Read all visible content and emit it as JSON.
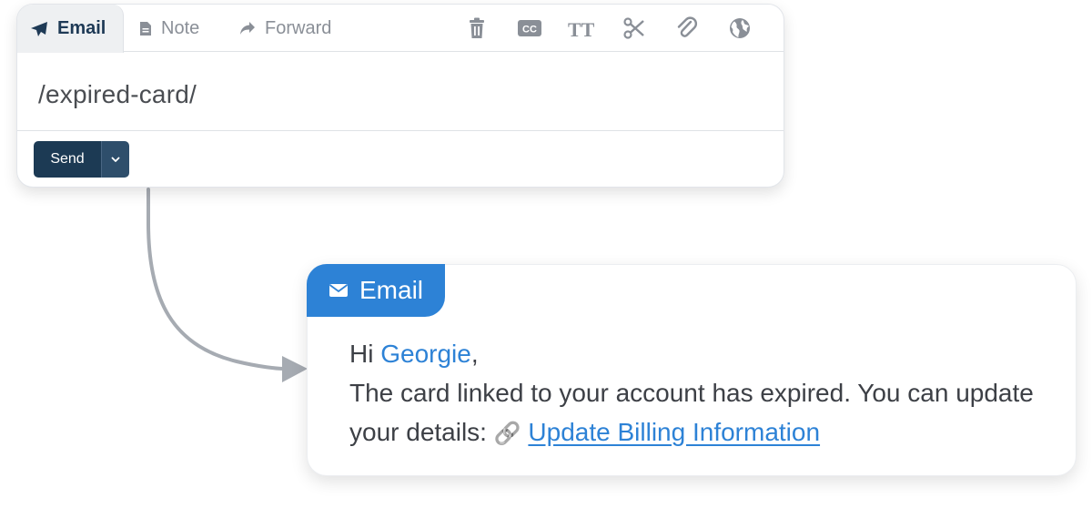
{
  "composer": {
    "tabs": [
      {
        "label": "Email",
        "icon": "paper-plane-icon",
        "active": true
      },
      {
        "label": "Note",
        "icon": "document-icon",
        "active": false
      },
      {
        "label": "Forward",
        "icon": "forward-arrow-icon",
        "active": false
      }
    ],
    "toolbar_icons": [
      "trash-icon",
      "cc-icon",
      "text-size-icon",
      "scissors-icon",
      "paperclip-icon",
      "globe-icon"
    ],
    "cc_label": "CC",
    "text_size_label": "TT",
    "editor_text": "/expired-card/",
    "send_label": "Send"
  },
  "preview": {
    "badge_label": "Email",
    "greeting_prefix": "Hi ",
    "recipient_name": "Georgie",
    "greeting_suffix": ",",
    "message": "The card linked to your account has expired. You can update your details: ",
    "link_icon": "🔗",
    "link_text": "Update Billing Information"
  },
  "colors": {
    "accent": "#2d82d6",
    "send_button": "#1c3a54",
    "active_tab_text": "#1e3a56",
    "connector": "#a6abb2"
  }
}
